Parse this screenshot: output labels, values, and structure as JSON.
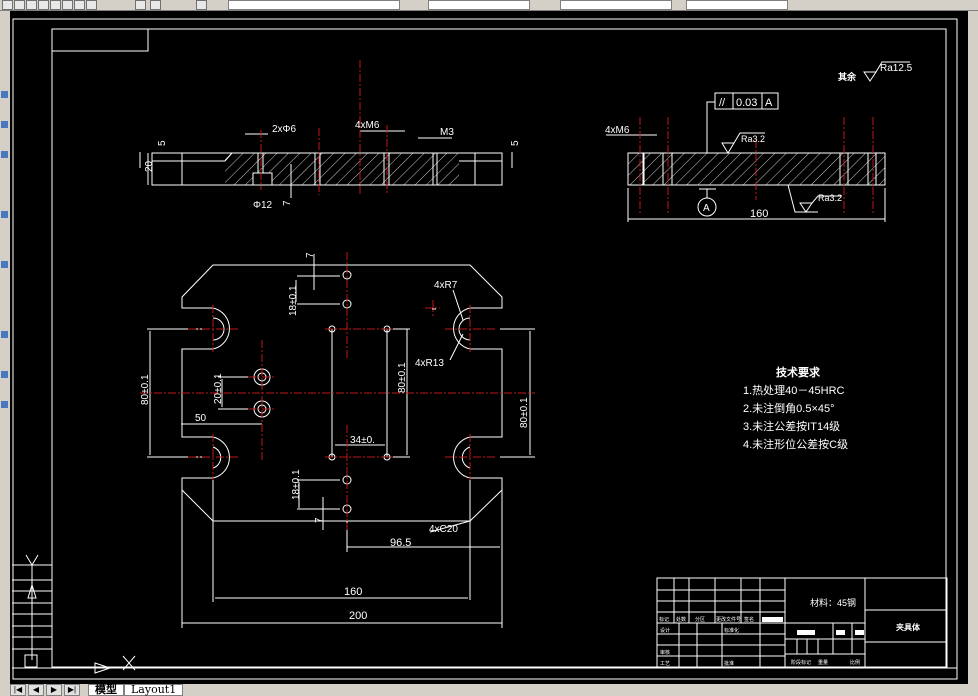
{
  "app": {
    "tabs": [
      {
        "label": "模型",
        "active": true
      },
      {
        "label": "Layout1",
        "active": false
      }
    ]
  },
  "colors": {
    "background": "#000000",
    "lines": "#ffffff",
    "centerlines": "#c01818"
  },
  "drawing": {
    "roughness_general": {
      "label": "其余",
      "value": "Ra12.5"
    },
    "section_view": {
      "dims": [
        "2xΦ6",
        "4xM6",
        "M3",
        "5",
        "5",
        "20",
        "Φ12",
        "7"
      ]
    },
    "side_view": {
      "thread": "4xM6",
      "tolerance": {
        "symbol": "//",
        "value": "0.03",
        "datum": "A"
      },
      "ra_top": "Ra3.2",
      "ra_bottom": "Ra3.2",
      "datum": "A",
      "length": "160"
    },
    "plan_view": {
      "dims": {
        "top7": "7",
        "top18": "18±0.1",
        "r7": "4xR7",
        "r13": "4xR13",
        "left80": "80±0.1",
        "d20": "20±0.1",
        "d50": "50",
        "c80": "80±0.1",
        "d34": "34±0.",
        "right80": "80±0.1",
        "bot18": "18±0.1",
        "bot7": "7",
        "c20": "4xC20",
        "d96": "96.5",
        "d160": "160",
        "d200": "200"
      }
    },
    "tech_requirements": {
      "title": "技术要求",
      "items": [
        "1.热处理40－45HRC",
        "2.未注倒角0.5×45°",
        "3.未注公差按IT14级",
        "4.未注形位公差按C级"
      ]
    },
    "title_block": {
      "material": "材料：45钢",
      "part_name": "夹具体",
      "labels": [
        "标记",
        "处数",
        "分区",
        "更改文件号",
        "签名",
        "设计",
        "标准化",
        "审核",
        "工艺",
        "批准",
        "阶段标记",
        "重量",
        "比例"
      ]
    }
  }
}
